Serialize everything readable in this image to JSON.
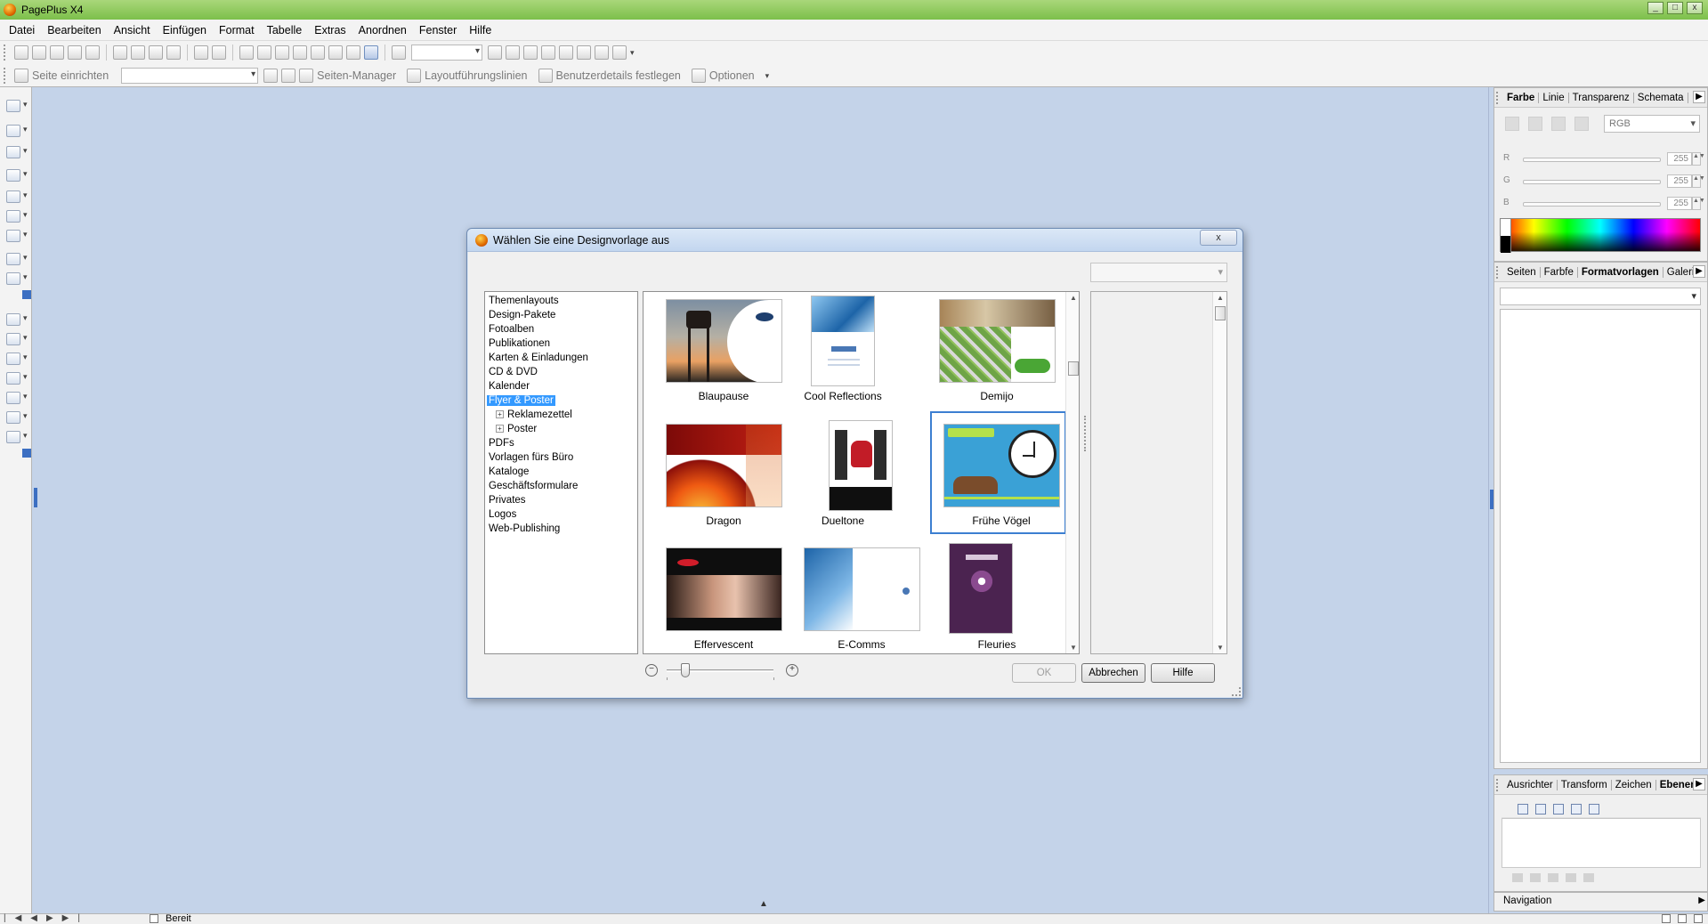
{
  "window": {
    "title": "PagePlus X4",
    "controls": [
      "_",
      "□",
      "x"
    ]
  },
  "menu": [
    "Datei",
    "Bearbeiten",
    "Ansicht",
    "Einfügen",
    "Format",
    "Tabelle",
    "Extras",
    "Anordnen",
    "Fenster",
    "Hilfe"
  ],
  "toolbar2": {
    "page_setup": "Seite einrichten",
    "page_manager": "Seiten-Manager",
    "layout_guides": "Layoutführungslinien",
    "user_details": "Benutzerdetails festlegen",
    "options": "Optionen"
  },
  "panels": {
    "color": {
      "tabs": [
        "Farbe",
        "Linie",
        "Transparenz",
        "Schemata"
      ],
      "active": "Farbe",
      "mode": "RGB",
      "sliders": [
        {
          "label": "R",
          "value": "255"
        },
        {
          "label": "G",
          "value": "255"
        },
        {
          "label": "B",
          "value": "255"
        }
      ]
    },
    "styles": {
      "tabs": [
        "Seiten",
        "Farbfe",
        "Formatvorlagen",
        "Galerie"
      ],
      "active": "Formatvorlagen"
    },
    "layers": {
      "tabs": [
        "Ausrichter",
        "Transform",
        "Zeichen",
        "Ebenen"
      ],
      "active": "Ebenen"
    },
    "navigation": {
      "label": "Navigation"
    }
  },
  "status": {
    "text": "Bereit"
  },
  "dialog": {
    "title": "Wählen Sie eine Designvorlage aus",
    "close": "x",
    "categories": [
      {
        "label": "Themenlayouts"
      },
      {
        "label": "Design-Pakete"
      },
      {
        "label": "Fotoalben"
      },
      {
        "label": "Publikationen"
      },
      {
        "label": "Karten & Einladungen"
      },
      {
        "label": "CD & DVD"
      },
      {
        "label": "Kalender"
      },
      {
        "label": "Flyer & Poster",
        "selected": true
      },
      {
        "label": "Reklamezettel",
        "child": true
      },
      {
        "label": "Poster",
        "child": true
      },
      {
        "label": "PDFs"
      },
      {
        "label": "Vorlagen fürs Büro"
      },
      {
        "label": "Kataloge"
      },
      {
        "label": "Geschäftsformulare"
      },
      {
        "label": "Privates"
      },
      {
        "label": "Logos"
      },
      {
        "label": "Web-Publishing"
      }
    ],
    "templates": [
      {
        "name": "Blaupause"
      },
      {
        "name": "Cool Reflections"
      },
      {
        "name": "Demijo"
      },
      {
        "name": "Dragon"
      },
      {
        "name": "Dueltone"
      },
      {
        "name": "Frühe Vögel",
        "selected": true
      },
      {
        "name": "Effervescent"
      },
      {
        "name": "E-Comms"
      },
      {
        "name": "Fleuries"
      }
    ],
    "buttons": {
      "ok": "OK",
      "cancel": "Abbrechen",
      "help": "Hilfe"
    }
  }
}
